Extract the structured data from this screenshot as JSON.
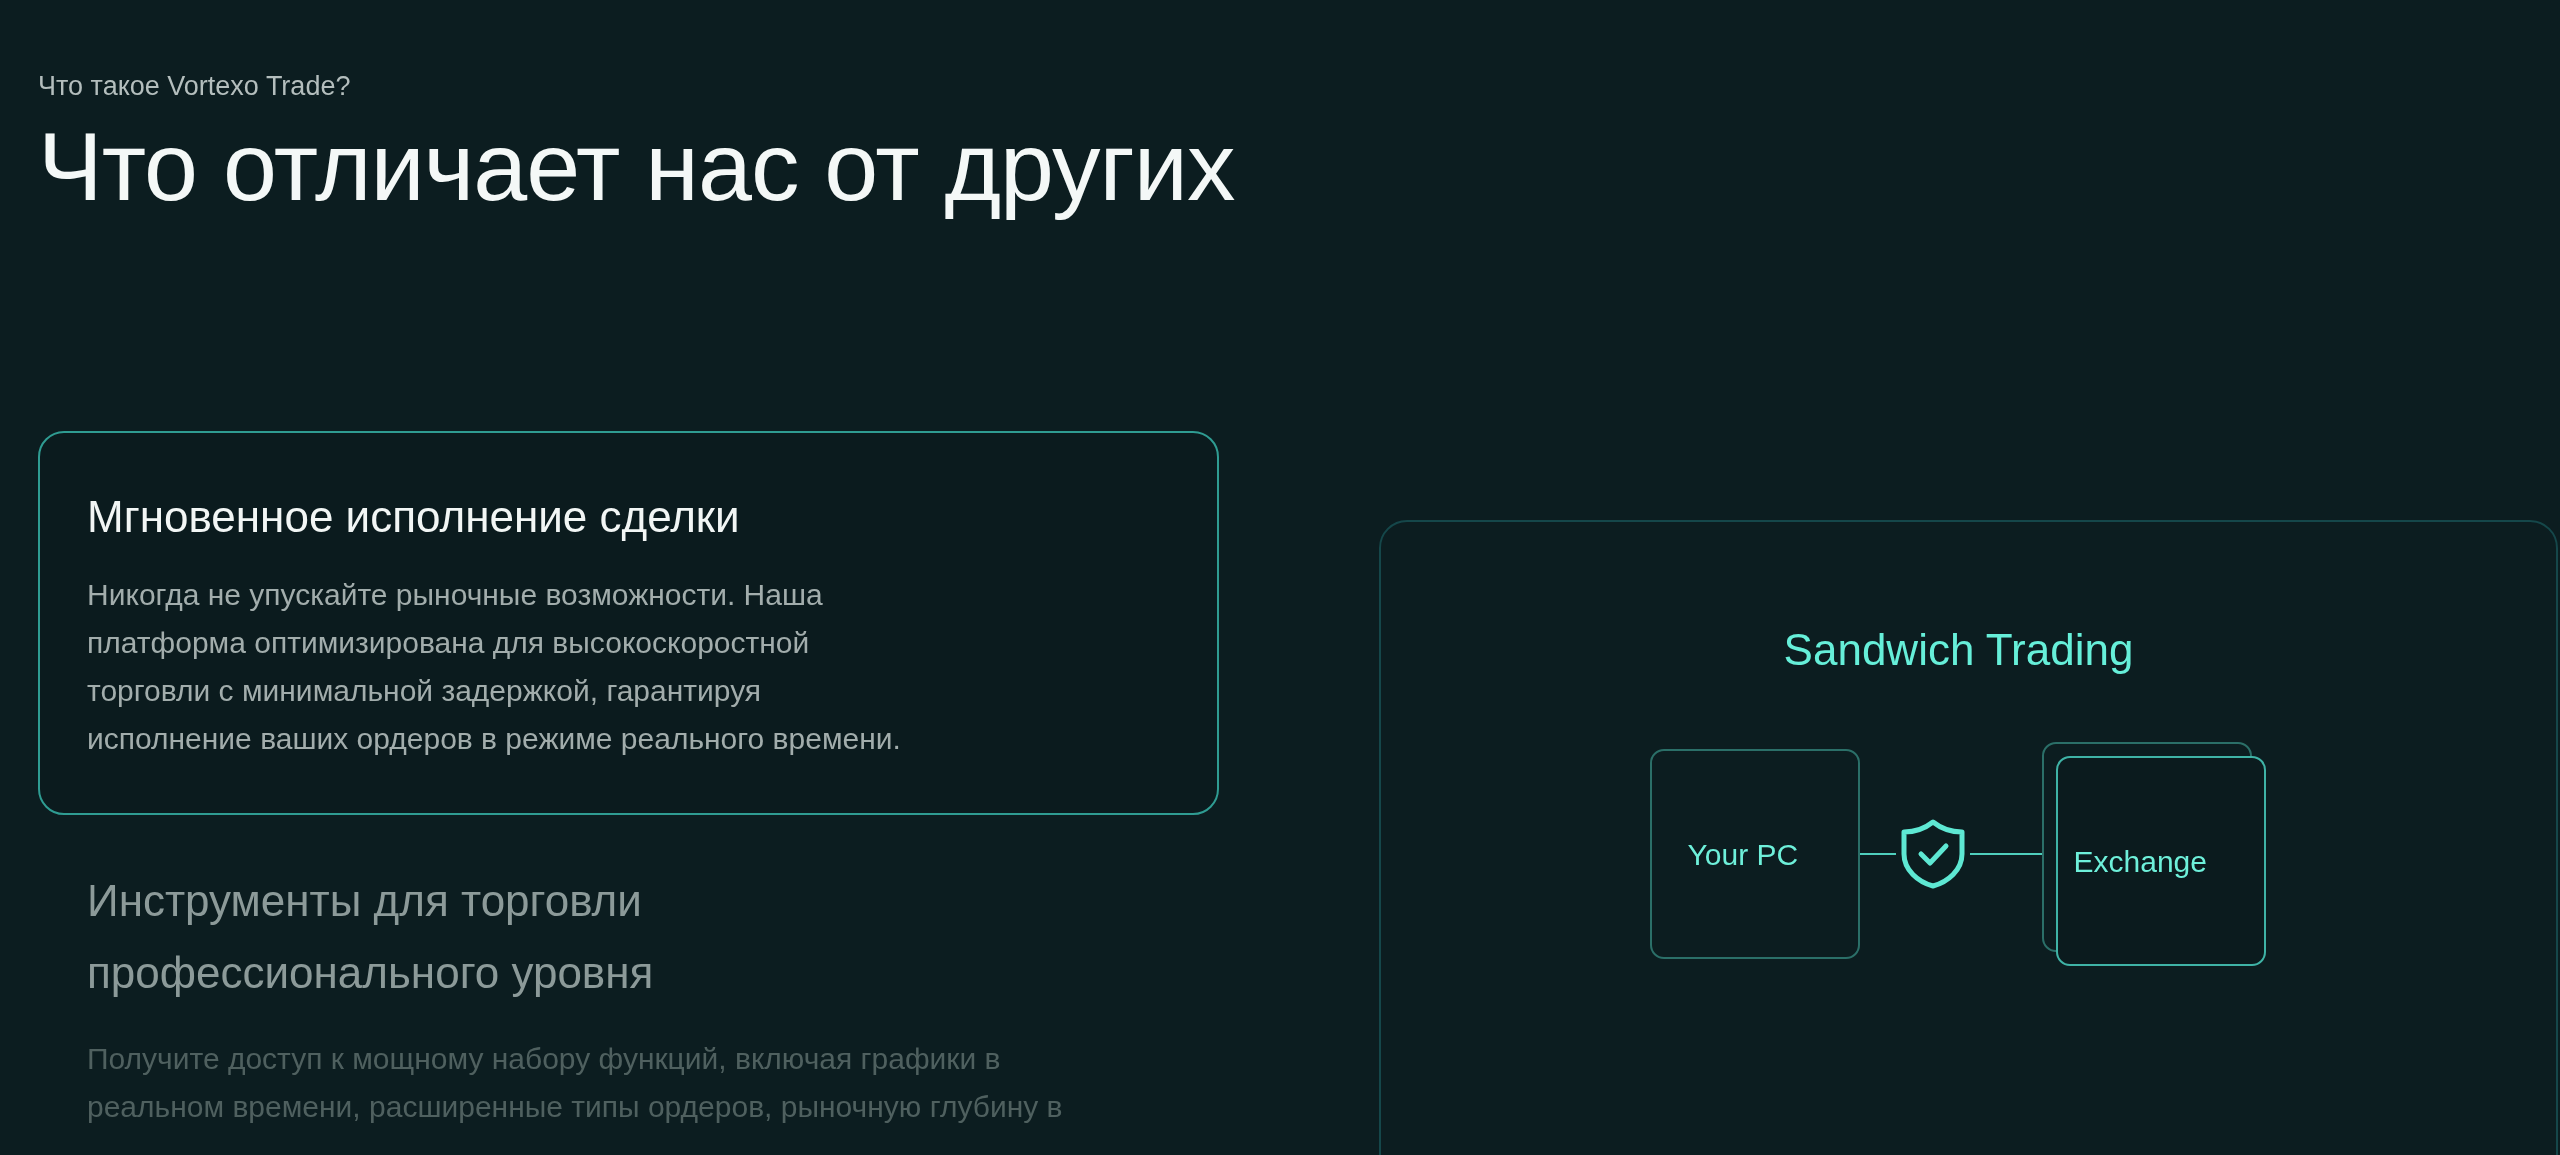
{
  "eyebrow": "Что такое Vortexo Trade?",
  "heading": "Что отличает нас от других",
  "features": [
    {
      "title": "Мгновенное исполнение сделки",
      "body": "Никогда не упускайте рыночные возможности. Наша платформа оптимизирована для высокоскоростной торговли с минимальной задержкой, гарантируя исполнение ваших ордеров в режиме реального времени.",
      "selected": true
    },
    {
      "title": "Инструменты для торговли профессионального уровня",
      "body": "Получите доступ к мощному набору функций, включая графики в реальном времени, расширенные типы ордеров, рыночную глубину в",
      "selected": false
    }
  ],
  "diagram": {
    "title": "Sandwich Trading",
    "nodes": [
      {
        "label": "Your PC",
        "kind": "single"
      },
      {
        "label": "Exchange",
        "kind": "stacked"
      }
    ]
  }
}
